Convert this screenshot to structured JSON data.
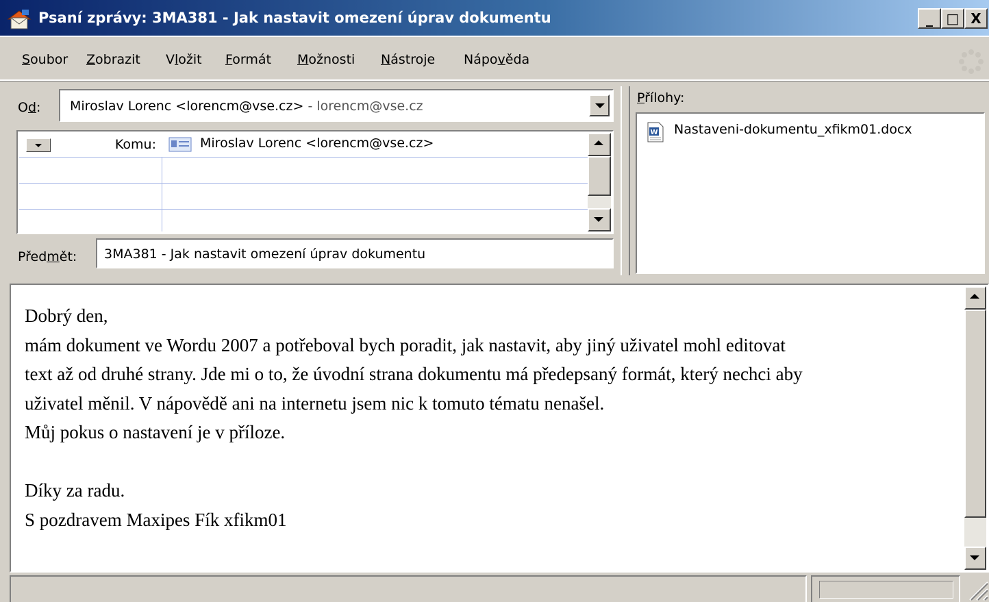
{
  "window": {
    "title": "Psaní zprávy: 3MA381 - Jak nastavit omezení úprav dokumentu",
    "minimize_label": "_",
    "maximize_label": "□",
    "close_label": "X"
  },
  "menu": {
    "items": [
      {
        "pre": "",
        "key": "S",
        "post": "oubor"
      },
      {
        "pre": "",
        "key": "Z",
        "post": "obrazit"
      },
      {
        "pre": "V",
        "key": "l",
        "post": "ožit"
      },
      {
        "pre": "",
        "key": "F",
        "post": "ormát"
      },
      {
        "pre": "",
        "key": "M",
        "post": "ožnosti"
      },
      {
        "pre": "",
        "key": "N",
        "post": "ástroje"
      },
      {
        "pre": "Nápo",
        "key": "v",
        "post": "ěda"
      }
    ]
  },
  "header": {
    "from_label_pre": "O",
    "from_label_key": "d",
    "from_label_post": ":",
    "from_value": "Miroslav Lorenc <lorencm@vse.cz>",
    "from_account": "  - lorencm@vse.cz",
    "recipient_type": "Komu:",
    "recipients": [
      "Miroslav Lorenc <lorencm@vse.cz>"
    ],
    "subject_label_pre": "Před",
    "subject_label_key": "m",
    "subject_label_post": "ět:",
    "subject_value": "3MA381 - Jak nastavit omezení úprav dokumentu"
  },
  "attachments": {
    "label_key": "P",
    "label_post": "řílohy:",
    "files": [
      {
        "name": "Nastaveni-dokumentu_xfikm01.docx",
        "icon": "word-document-icon"
      }
    ]
  },
  "body": {
    "lines": [
      "Dobrý den,",
      "mám dokument ve Wordu 2007 a potřeboval bych poradit, jak nastavit, aby jiný uživatel mohl editovat",
      "text až od druhé strany. Jde mi o to, že úvodní strana dokumentu má předepsaný formát, který nechci aby",
      "uživatel měnil. V nápovědě ani na internetu jsem nic k tomuto tématu nenašel.",
      "Můj pokus o nastavení je v příloze.",
      "",
      "Díky za radu.",
      "S pozdravem Maxipes Fík xfikm01"
    ]
  },
  "colors": {
    "title_gradient_start": "#0a246a",
    "title_gradient_end": "#a6caf0",
    "chrome": "#d4d0c8",
    "grid_line": "#a6b6e6"
  }
}
